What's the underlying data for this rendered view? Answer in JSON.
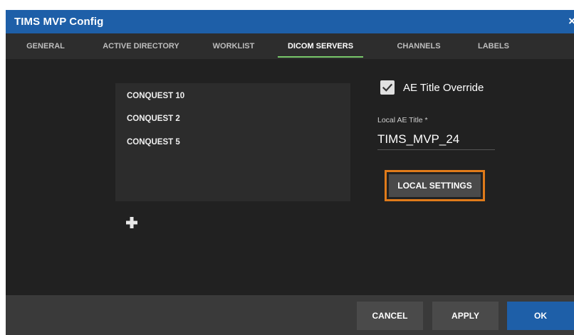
{
  "window": {
    "title": "TIMS MVP Config",
    "close_glyph": "×"
  },
  "tabs": [
    {
      "label": "GENERAL",
      "active": false
    },
    {
      "label": "ACTIVE DIRECTORY",
      "active": false
    },
    {
      "label": "WORKLIST",
      "active": false
    },
    {
      "label": "DICOM SERVERS",
      "active": true
    },
    {
      "label": "CHANNELS",
      "active": false
    },
    {
      "label": "LABELS",
      "active": false
    }
  ],
  "servers": {
    "items": [
      "CONQUEST 10",
      "CONQUEST 2",
      "CONQUEST 5"
    ],
    "add_icon": "plus-icon"
  },
  "settings": {
    "ae_override_label": "AE Title Override",
    "ae_override_checked": true,
    "local_ae_label": "Local AE Title *",
    "local_ae_value": "TIMS_MVP_24",
    "local_settings_label": "LOCAL SETTINGS"
  },
  "footer": {
    "cancel_label": "CANCEL",
    "apply_label": "APPLY",
    "ok_label": "OK"
  },
  "colors": {
    "title_bar": "#1e5fa8",
    "dialog_bg": "#212121",
    "tab_active_underline": "#78c86a",
    "highlight_border": "#e07b1a",
    "ok_button": "#1e5fa8"
  }
}
